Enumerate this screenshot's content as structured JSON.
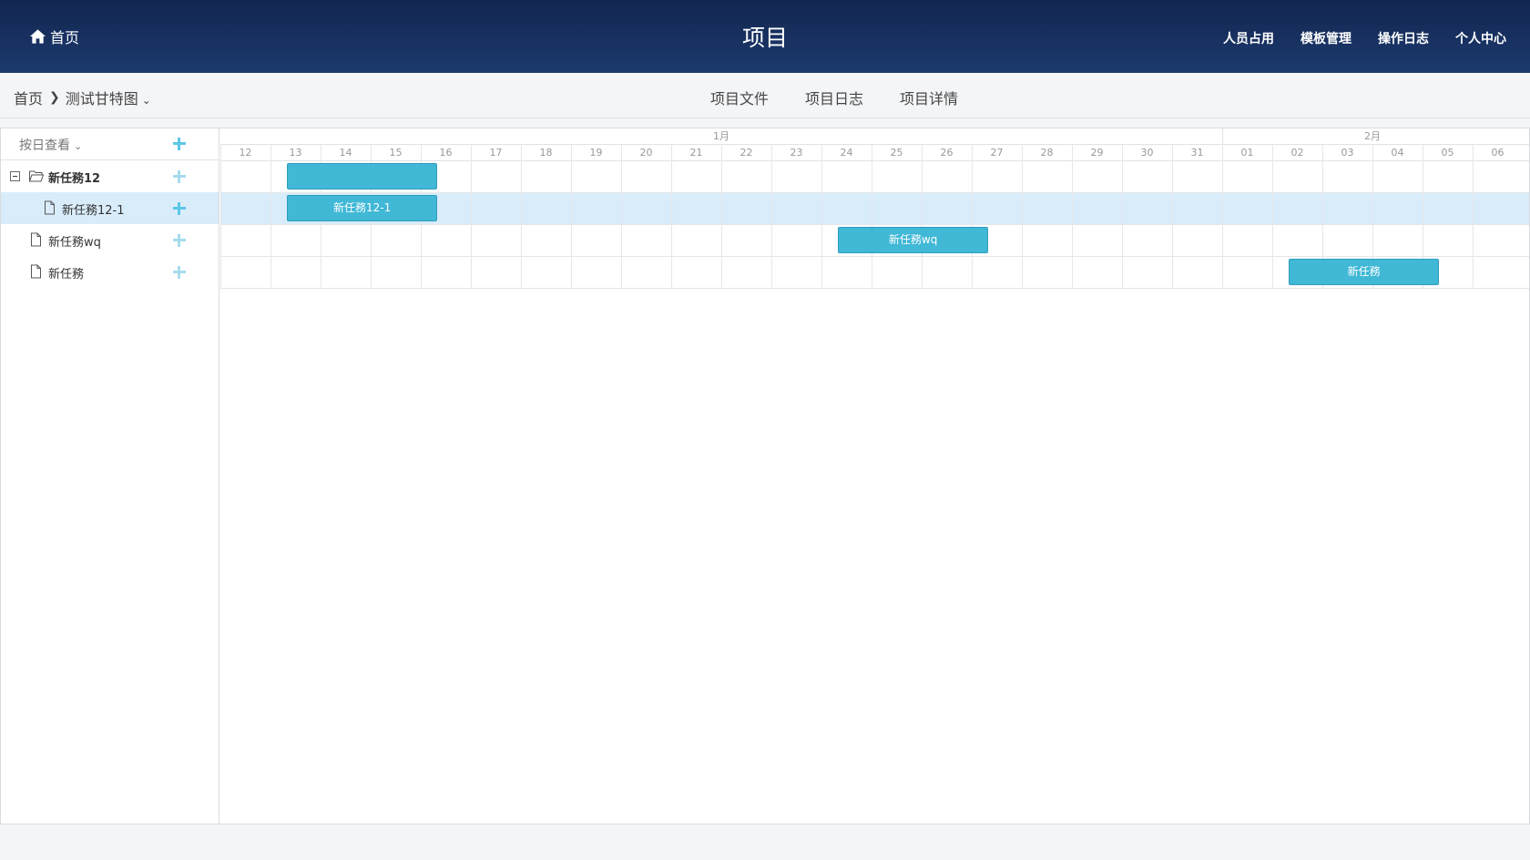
{
  "header": {
    "home_label": "首页",
    "title": "项目",
    "nav": [
      "人员占用",
      "模板管理",
      "操作日志",
      "个人中心"
    ]
  },
  "subbar": {
    "breadcrumb_home": "首页",
    "breadcrumb_project": "测试甘特图",
    "tabs": [
      "项目文件",
      "项目日志",
      "项目详情"
    ]
  },
  "tree": {
    "view_mode": "按日查看",
    "rows": [
      {
        "label": "新任務12",
        "type": "folder",
        "expanded": true,
        "level": 0,
        "selected": false
      },
      {
        "label": "新任務12-1",
        "type": "file",
        "level": 1,
        "selected": true
      },
      {
        "label": "新任務wq",
        "type": "file",
        "level": 0,
        "selected": false
      },
      {
        "label": "新任務",
        "type": "file",
        "level": 0,
        "selected": false
      }
    ]
  },
  "timeline": {
    "months": [
      {
        "label": "1月",
        "days": [
          "12",
          "13",
          "14",
          "15",
          "16",
          "17",
          "18",
          "19",
          "20",
          "21",
          "22",
          "23",
          "24",
          "25",
          "26",
          "27",
          "28",
          "29",
          "30",
          "31"
        ]
      },
      {
        "label": "2月",
        "days": [
          "01",
          "02",
          "03",
          "04",
          "05",
          "06"
        ]
      }
    ],
    "tasks": [
      {
        "row": 0,
        "label": "",
        "start_day": 13.33,
        "end_day": 16.33
      },
      {
        "row": 1,
        "label": "新任務12-1",
        "start_day": 13.33,
        "end_day": 16.33
      },
      {
        "row": 2,
        "label": "新任務wq",
        "start_day": 24.33,
        "end_day": 27.33
      },
      {
        "row": 3,
        "label": "新任務",
        "start_day": 33.33,
        "end_day": 36.33
      }
    ]
  },
  "colors": {
    "header_bg": "#1c3a6e",
    "bar_fill": "#40b8d6",
    "selected_row": "#d9ecfa",
    "add_icon": "#5cc7e6"
  }
}
